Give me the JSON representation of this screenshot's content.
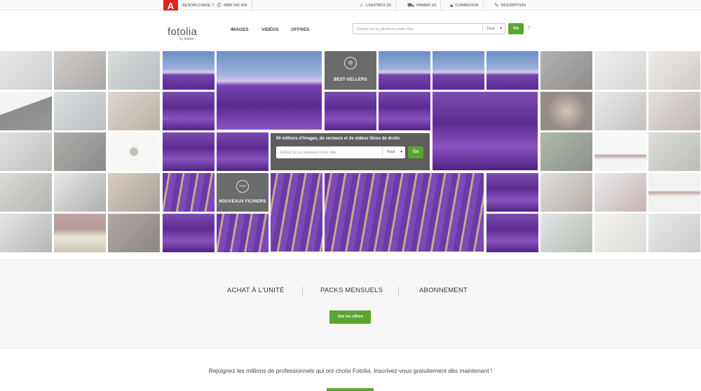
{
  "topbar": {
    "adobe_logo": "Adobe",
    "help_label": "BESOIN D'AIDE ?",
    "phone": "0805 542 609",
    "lightbox": "LIGHTBOX (0)",
    "cart": "PANIER (0)",
    "login": "CONNEXION",
    "signup": "INSCRIPTION"
  },
  "header": {
    "brand": "fotolia",
    "brand_sub": "by Adobe",
    "nav": [
      "IMAGES",
      "VIDÉOS",
      "OFFRES"
    ],
    "search_placeholder": "Entrez un ou plusieurs mots clés",
    "search_category": "Tous",
    "go": "Go",
    "help": "?"
  },
  "mosaic": {
    "best_sellers": "BEST-SELLERS",
    "new_files": "NOUVEAUX FICHIERS",
    "new_badge": "new",
    "panel_title": "50 millions d'images, de vecteurs et de vidéos libres de droits",
    "panel_placeholder": "Entrez un ou plusieurs mots clés",
    "panel_category": "Tous",
    "panel_go": "Go"
  },
  "offers": {
    "items": [
      "ACHAT À L'UNITÉ",
      "PACKS MENSUELS",
      "ABONNEMENT"
    ],
    "button": "Voir les offres"
  },
  "join": {
    "text": "Rejoignez les millions de professionnels qui ont choisi Fotolia. Inscrivez-vous gratuitement dès maintenant !"
  },
  "colors": {
    "accent_green": "#5aa631",
    "adobe_red": "#e1251b",
    "lavender": "#6b3aa6",
    "card_gray": "#6b6b6b"
  },
  "icons": {
    "phone": "phone-icon",
    "lightbox": "star-icon",
    "cart": "cart-icon",
    "login": "lock-icon",
    "signup": "pencil-icon",
    "best_sellers": "ribbon-icon",
    "dropdown": "chevron-down-icon"
  }
}
